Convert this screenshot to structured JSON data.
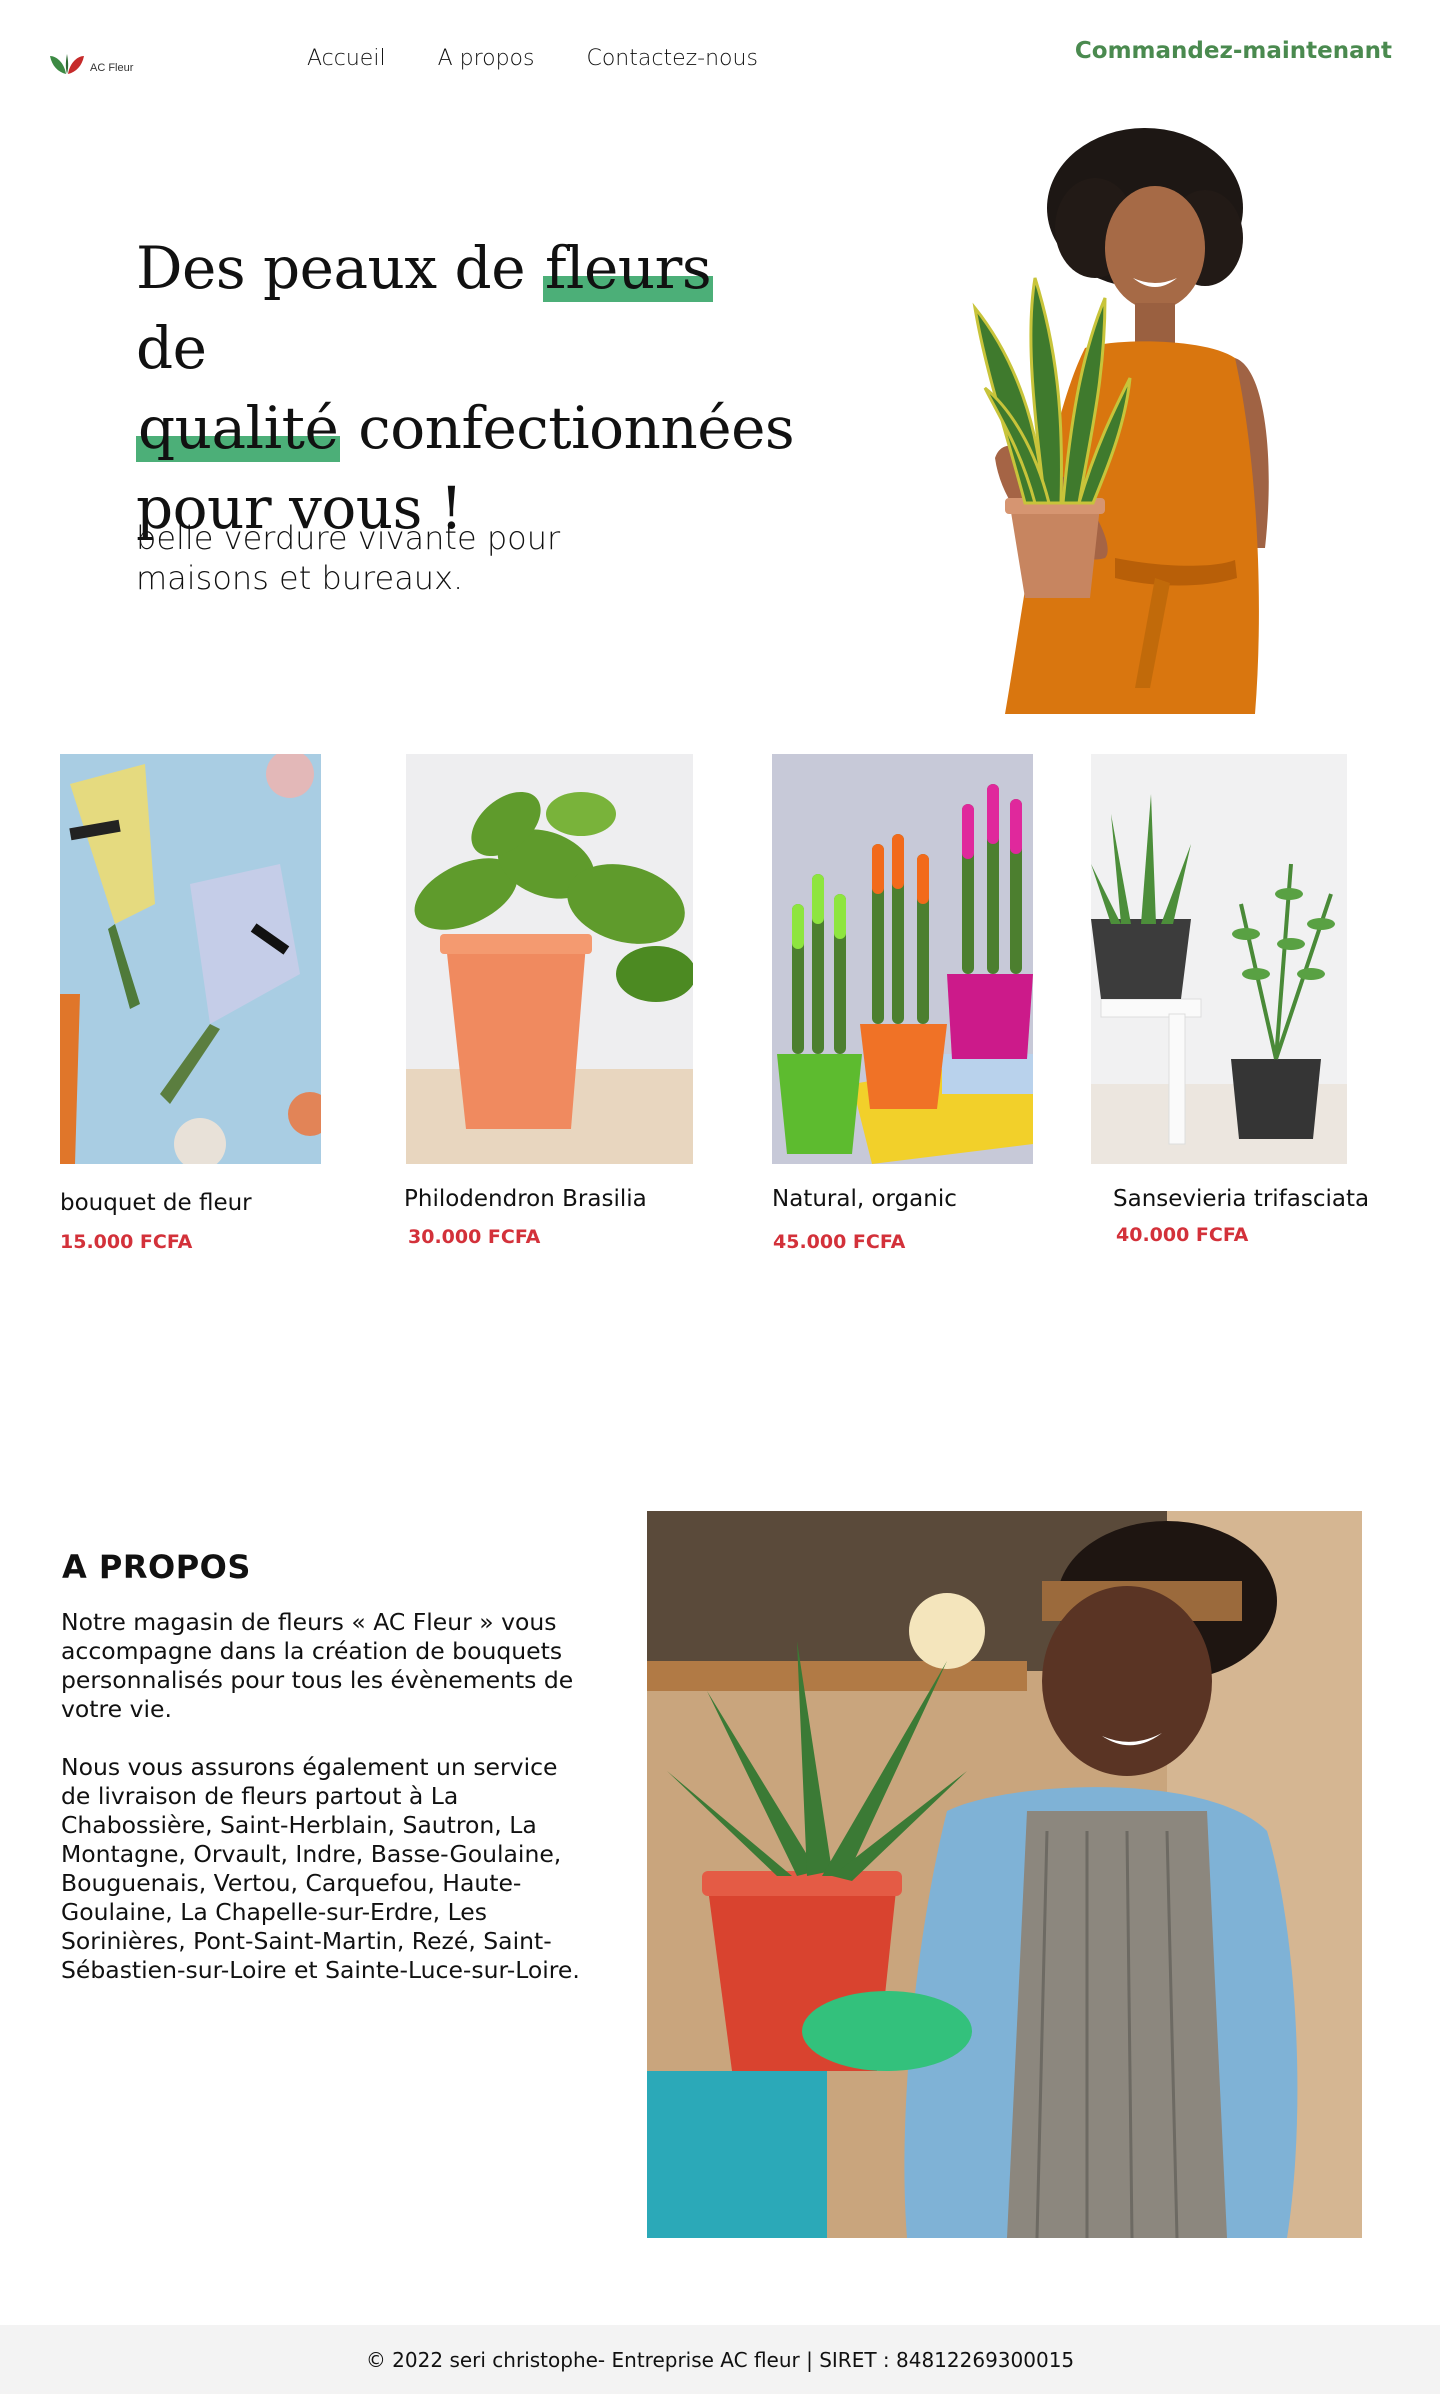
{
  "brand": {
    "name": "AC Fleur"
  },
  "nav": {
    "items": [
      "Accueil",
      "A propos",
      "Contactez-nous"
    ]
  },
  "cta": {
    "label": "Commandez-maintenant"
  },
  "hero": {
    "title_part1": "Des peaux de ",
    "title_hl1": "fleurs",
    "title_part2": " de",
    "title_hl2": "qualité",
    "title_part3": " confectionnées",
    "title_part4": "pour vous !",
    "subtitle": "belle verdure vivante pour maisons et bureaux."
  },
  "products": [
    {
      "name": "bouquet de fleur",
      "price": "15.000 FCFA"
    },
    {
      "name": "Philodendron Brasilia",
      "price": "30.000 FCFA"
    },
    {
      "name": "Natural, organic",
      "price": "45.000 FCFA"
    },
    {
      "name": "Sansevieria trifasciata",
      "price": "40.000 FCFA"
    }
  ],
  "about": {
    "title": "A PROPOS",
    "paragraph1": "Notre magasin de fleurs « AC Fleur » vous accompagne dans la création de bouquets personnalisés pour tous les évènements de votre vie.",
    "paragraph2": "Nous vous assurons également un service de livraison de fleurs partout à La Chabossière, Saint-Herblain, Sautron, La Montagne, Orvault, Indre, Basse-Goulaine, Bouguenais, Vertou, Carquefou, Haute-Goulaine, La Chapelle-sur-Erdre, Les Sorinières, Pont-Saint-Martin, Rezé, Saint-Sébastien-sur-Loire et Sainte-Luce-sur-Loire."
  },
  "footer": {
    "text": "© 2022 seri christophe- Entreprise AC fleur   | SIRET : 84812269300015"
  },
  "colors": {
    "accent_green": "#4a8a4f",
    "highlight_green": "#4caf78",
    "price_red": "#d3313a",
    "footer_bg": "#f3f3f3"
  }
}
